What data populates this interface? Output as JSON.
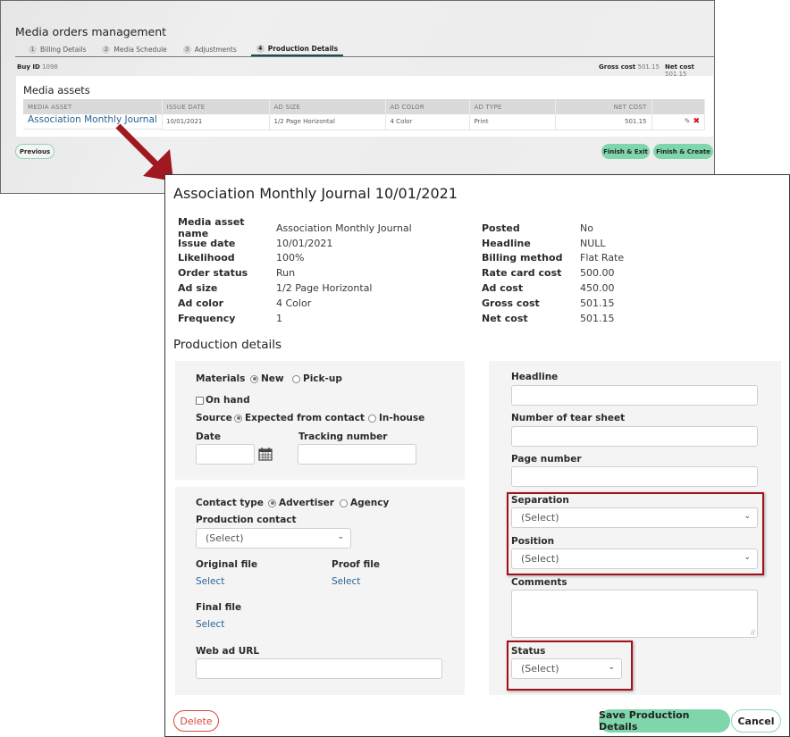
{
  "background_window": {
    "title": "Media orders management",
    "tabs": [
      {
        "num": "1",
        "label": "Billing Details",
        "active": false
      },
      {
        "num": "2",
        "label": "Media Schedule",
        "active": false
      },
      {
        "num": "3",
        "label": "Adjustments",
        "active": false
      },
      {
        "num": "4",
        "label": "Production Details",
        "active": true
      }
    ],
    "buy_id_label": "Buy ID",
    "buy_id_value": "1098",
    "gross_cost_label": "Gross cost",
    "gross_cost_value": "501.15",
    "net_cost_label": "Net cost",
    "net_cost_value": "501.15",
    "assets": {
      "title": "Media assets",
      "columns": [
        "MEDIA ASSET",
        "ISSUE DATE",
        "AD SIZE",
        "AD COLOR",
        "AD TYPE",
        "NET COST",
        ""
      ],
      "rows": [
        {
          "media_asset": "Association Monthly Journal",
          "issue_date": "10/01/2021",
          "ad_size": "1/2 Page Horizontal",
          "ad_color": "4 Color",
          "ad_type": "Print",
          "net_cost": "501.15",
          "edit_icon": "✎",
          "delete_icon": "✖"
        }
      ]
    },
    "buttons": {
      "previous": "Previous",
      "finish_exit": "Finish & Exit",
      "finish_create": "Finish & Create"
    }
  },
  "dialog": {
    "title": "Association Monthly Journal 10/01/2021",
    "info_left": [
      {
        "label": "Media asset name",
        "value": "Association Monthly Journal"
      },
      {
        "label": "Issue date",
        "value": "10/01/2021"
      },
      {
        "label": "Likelihood",
        "value": "100%"
      },
      {
        "label": "Order status",
        "value": "Run"
      },
      {
        "label": "Ad size",
        "value": "1/2 Page Horizontal"
      },
      {
        "label": "Ad color",
        "value": "4 Color"
      },
      {
        "label": "Frequency",
        "value": "1"
      }
    ],
    "info_right": [
      {
        "label": "Posted",
        "value": "No"
      },
      {
        "label": "Headline",
        "value": "NULL"
      },
      {
        "label": "Billing method",
        "value": "Flat Rate"
      },
      {
        "label": "Rate card cost",
        "value": "500.00"
      },
      {
        "label": "Ad cost",
        "value": "450.00"
      },
      {
        "label": "Gross cost",
        "value": "501.15"
      },
      {
        "label": "Net cost",
        "value": "501.15"
      }
    ],
    "production_title": "Production details",
    "materials": {
      "label": "Materials",
      "options": [
        {
          "label": "New",
          "selected": true
        },
        {
          "label": "Pick-up",
          "selected": false
        }
      ],
      "on_hand_label": "On hand",
      "on_hand_checked": false
    },
    "source": {
      "label": "Source",
      "options": [
        {
          "label": "Expected from contact",
          "selected": true
        },
        {
          "label": "In-house",
          "selected": false
        }
      ]
    },
    "date": {
      "label": "Date",
      "value": ""
    },
    "tracking_number": {
      "label": "Tracking number",
      "value": ""
    },
    "contact_type": {
      "label": "Contact type",
      "options": [
        {
          "label": "Advertiser",
          "selected": true
        },
        {
          "label": "Agency",
          "selected": false
        }
      ]
    },
    "production_contact": {
      "label": "Production contact",
      "selected": "(Select)"
    },
    "original_file": {
      "label": "Original file",
      "link": "Select"
    },
    "proof_file": {
      "label": "Proof file",
      "link": "Select"
    },
    "final_file": {
      "label": "Final file",
      "link": "Select"
    },
    "web_ad_url": {
      "label": "Web ad URL",
      "value": ""
    },
    "headline": {
      "label": "Headline",
      "value": ""
    },
    "tear_sheet": {
      "label": "Number of tear sheet",
      "value": ""
    },
    "page_number": {
      "label": "Page number",
      "value": ""
    },
    "separation": {
      "label": "Separation",
      "selected": "(Select)"
    },
    "position": {
      "label": "Position",
      "selected": "(Select)"
    },
    "comments": {
      "label": "Comments",
      "value": ""
    },
    "status": {
      "label": "Status",
      "selected": "(Select)"
    },
    "buttons": {
      "delete": "Delete",
      "save": "Save Production Details",
      "cancel": "Cancel"
    }
  },
  "colors": {
    "accent_green": "#7fd6ab",
    "link_blue": "#2a6496",
    "danger_red": "#d9463e",
    "highlight_red": "#a1111b",
    "arrow_red": "#a01820"
  }
}
